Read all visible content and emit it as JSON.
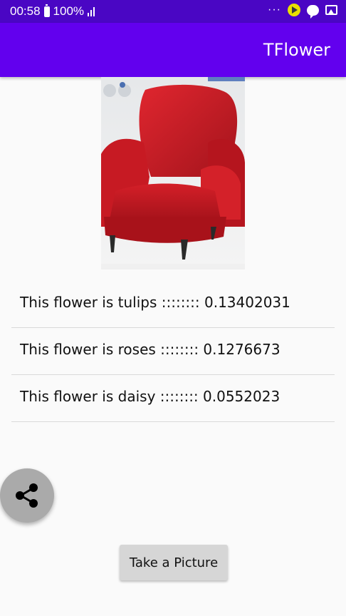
{
  "status_bar": {
    "time": "00:58",
    "battery": "100%",
    "more": "···",
    "icons": [
      "battery-icon",
      "signal-icon",
      "more-icon",
      "play-icon",
      "chat-icon",
      "gallery-icon"
    ]
  },
  "app_bar": {
    "title": "TFlower"
  },
  "results": [
    "This flower is tulips  ::::::::  0.13402031",
    "This flower is roses  ::::::::  0.1276673",
    "This flower is daisy  ::::::::  0.0552023"
  ],
  "fab": {
    "icon": "share-icon"
  },
  "take_picture_label": "Take a Picture",
  "colors": {
    "status_bar": "#4a06c4",
    "app_bar": "#6200ee",
    "background": "#fafafa",
    "fab": "#aaaaaa",
    "button": "#d6d6d6",
    "chair": "#cc1f28"
  }
}
